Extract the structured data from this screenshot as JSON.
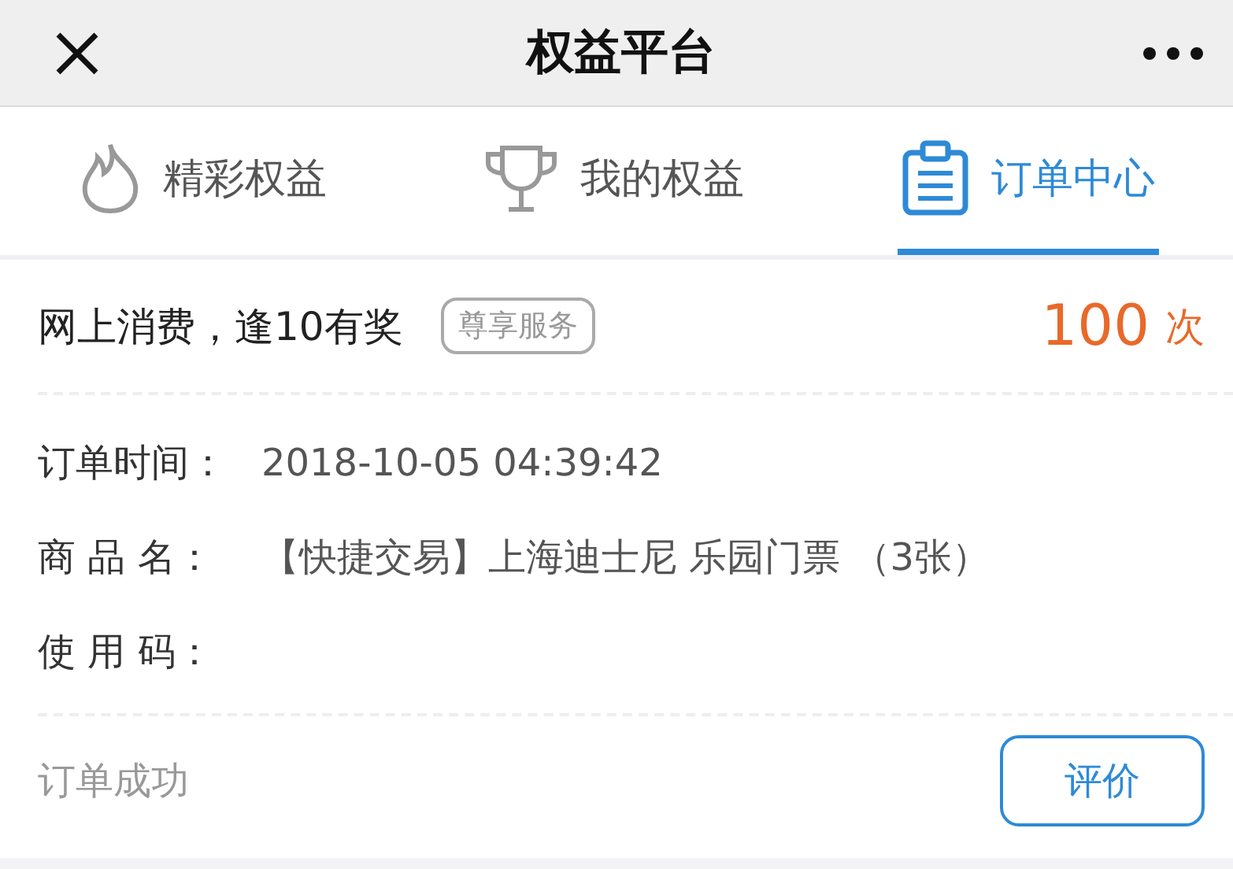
{
  "header": {
    "title": "权益平台"
  },
  "tabs": [
    {
      "label": "精彩权益",
      "kind": "flame",
      "selected": false
    },
    {
      "label": "我的权益",
      "kind": "trophy",
      "selected": false
    },
    {
      "label": "订单中心",
      "kind": "clipboard",
      "selected": true
    }
  ],
  "order": {
    "title": "网上消费，逢10有奖",
    "tag": "尊享服务",
    "count": "100",
    "count_unit": "次",
    "fields": [
      {
        "label": "订单时间：",
        "value": "2018-10-05 04:39:42"
      },
      {
        "label": "商 品 名：",
        "value": "【快捷交易】上海迪士尼 乐园门票 （3张）"
      },
      {
        "label": "使 用 码："
      }
    ],
    "status": "订单成功",
    "button": "评价"
  }
}
